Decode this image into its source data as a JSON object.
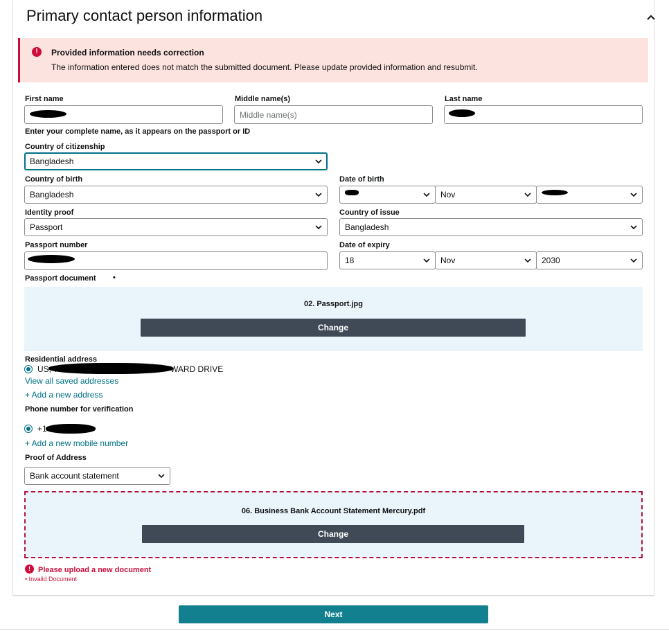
{
  "section": {
    "title": "Primary contact person information",
    "collapse_icon": "chevron-up-icon"
  },
  "alert": {
    "icon": "!",
    "title": "Provided information needs correction",
    "body": "The information entered does not match the submitted document. Please update provided information and resubmit."
  },
  "name": {
    "first_label": "First name",
    "first_value": "",
    "middle_label": "Middle name(s)",
    "middle_placeholder": "Middle name(s)",
    "last_label": "Last name",
    "last_value": "",
    "hint": "Enter your complete name, as it appears on the passport or ID"
  },
  "citizenship": {
    "label": "Country of citizenship",
    "value": "Bangladesh"
  },
  "birth_country": {
    "label": "Country of birth",
    "value": "Bangladesh"
  },
  "dob": {
    "label": "Date of birth",
    "day": "",
    "month": "Nov",
    "year": ""
  },
  "identity": {
    "label": "Identity proof",
    "value": "Passport"
  },
  "issue_country": {
    "label": "Country of issue",
    "value": "Bangladesh"
  },
  "passport_number": {
    "label": "Passport number",
    "value": ""
  },
  "expiry": {
    "label": "Date of expiry",
    "day": "18",
    "month": "Nov",
    "year": "2030"
  },
  "passport_doc": {
    "label": "Passport document",
    "bullet": "•",
    "file": "02. Passport.jpg",
    "change": "Change"
  },
  "address": {
    "label": "Residential address",
    "prefix": "US, 7",
    "suffix": "WARD DRIVE",
    "view_all": "View all saved addresses",
    "add_new": "+ Add a new address"
  },
  "phone": {
    "label": "Phone number for verification",
    "value": "+1",
    "add_new": "+ Add a new mobile number"
  },
  "proof_address": {
    "label": "Proof of Address",
    "value": "Bank account statement",
    "file": "06. Business Bank Account Statement Mercury.pdf",
    "change": "Change",
    "error_icon": "!",
    "error_title": "Please upload a new document",
    "error_sub": "• Invalid Document"
  },
  "next": "Next"
}
